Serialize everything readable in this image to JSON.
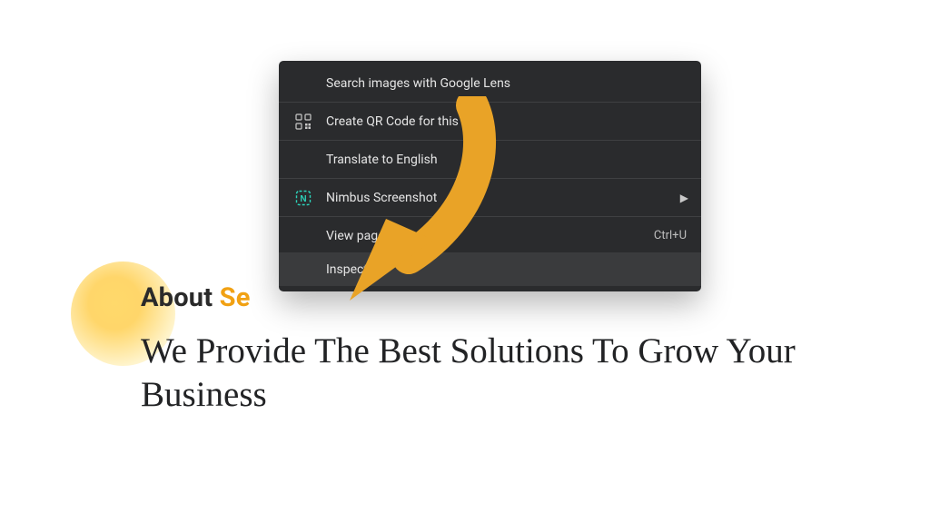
{
  "page": {
    "about_label_dark": "About ",
    "about_label_accent": "Se",
    "headline": "We Provide The Best Solutions To Grow Your Business"
  },
  "context_menu": {
    "items": [
      {
        "label": "Search images with Google Lens",
        "icon": "",
        "shortcut": "",
        "submenu": false
      },
      {
        "label": "Create QR Code for this page",
        "icon": "qr",
        "shortcut": "",
        "submenu": false
      },
      {
        "label": "Translate to English",
        "icon": "",
        "shortcut": "",
        "submenu": false
      },
      {
        "label": "Nimbus Screenshot",
        "icon": "nimbus",
        "shortcut": "",
        "submenu": true
      },
      {
        "label": "View page source",
        "icon": "",
        "shortcut": "Ctrl+U",
        "submenu": false
      },
      {
        "label": "Inspect",
        "icon": "",
        "shortcut": "",
        "submenu": false
      }
    ]
  },
  "colors": {
    "accent": "#f1a113",
    "arrow": "#e9a327"
  }
}
